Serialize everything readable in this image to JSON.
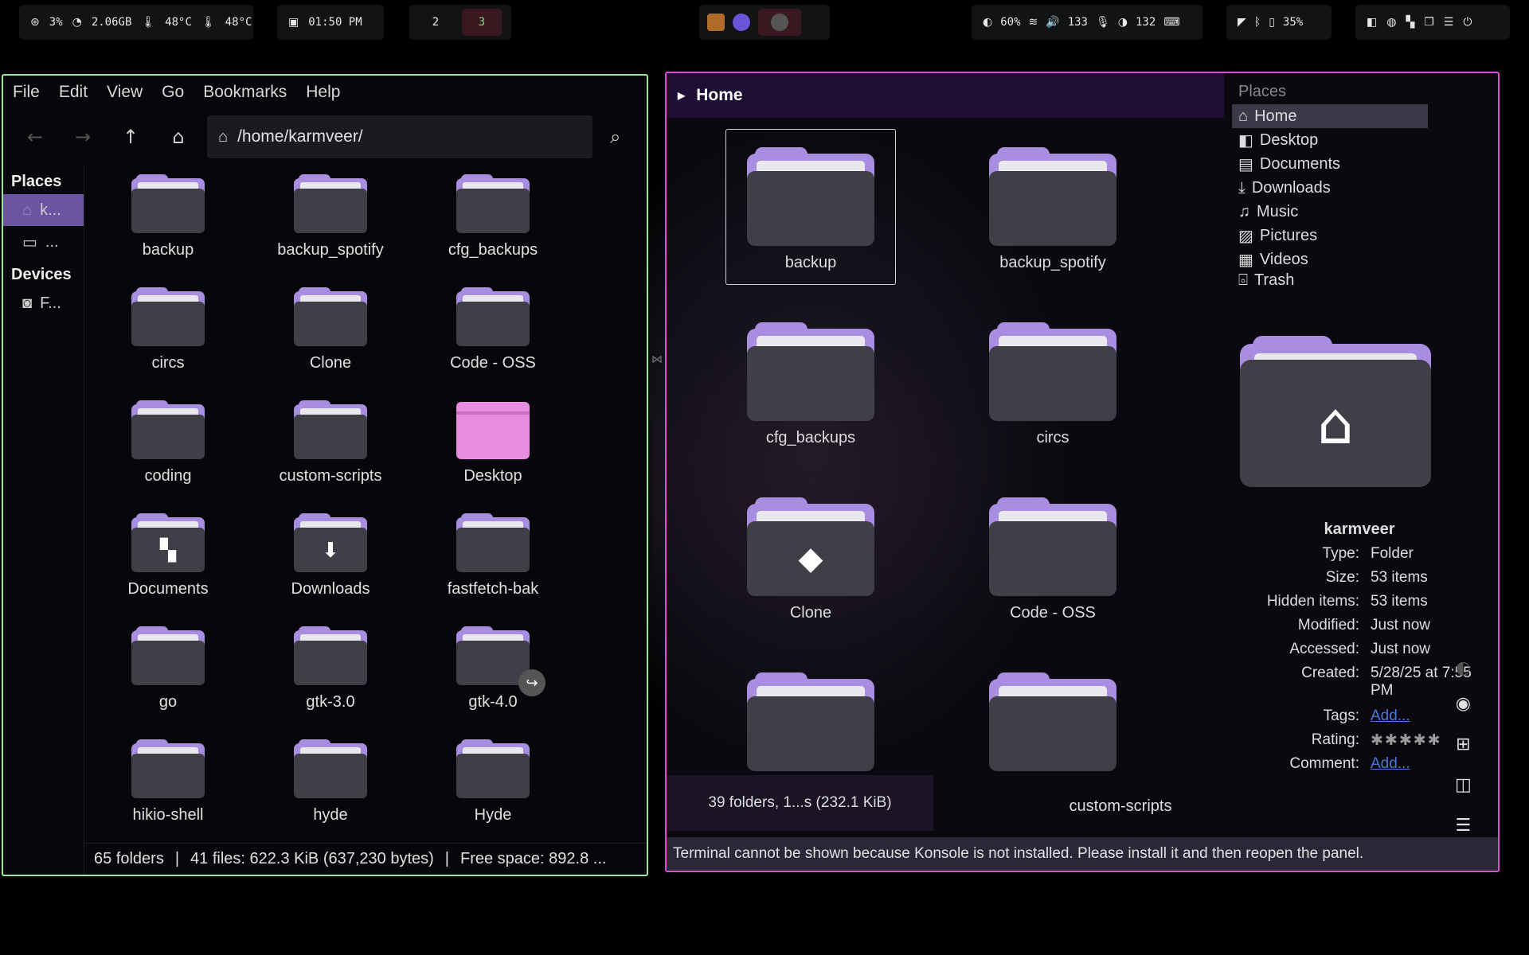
{
  "topbar": {
    "sys": {
      "cpu": "3%",
      "mem": "2.06GB",
      "temp1": "48°C",
      "temp2": "48°C"
    },
    "clock": "01:50 PM",
    "workspaces": [
      "2",
      "3"
    ],
    "controls": {
      "brightness": "60%",
      "volume": "133",
      "mic": "132"
    },
    "battery": "35%"
  },
  "left": {
    "menu": [
      "File",
      "Edit",
      "View",
      "Go",
      "Bookmarks",
      "Help"
    ],
    "path": "/home/karmveer/",
    "sidebar": {
      "places_header": "Places",
      "home_label": "k...",
      "drive_label": "...",
      "devices_header": "Devices",
      "device_label": "F..."
    },
    "items": [
      {
        "name": "backup",
        "type": "folder"
      },
      {
        "name": "backup_spotify",
        "type": "folder"
      },
      {
        "name": "cfg_backups",
        "type": "folder"
      },
      {
        "name": "circs",
        "type": "folder"
      },
      {
        "name": "Clone",
        "type": "folder"
      },
      {
        "name": "Code - OSS",
        "type": "folder"
      },
      {
        "name": "coding",
        "type": "folder"
      },
      {
        "name": "custom-scripts",
        "type": "folder"
      },
      {
        "name": "Desktop",
        "type": "desktop"
      },
      {
        "name": "Documents",
        "type": "documents"
      },
      {
        "name": "Downloads",
        "type": "downloads"
      },
      {
        "name": "fastfetch-bak",
        "type": "folder"
      },
      {
        "name": "go",
        "type": "folder"
      },
      {
        "name": "gtk-3.0",
        "type": "folder"
      },
      {
        "name": "gtk-4.0",
        "type": "link"
      },
      {
        "name": "hikio-shell",
        "type": "folder"
      },
      {
        "name": "hyde",
        "type": "folder"
      },
      {
        "name": "Hyde",
        "type": "folder"
      }
    ],
    "status": {
      "folders": "65 folders",
      "files": "41 files: 622.3 KiB (637,230 bytes)",
      "free": "Free space: 892.8 ..."
    }
  },
  "right": {
    "header": "Home",
    "items": [
      "backup",
      "backup_spotify",
      "cfg_backups",
      "circs",
      "Clone",
      "Code - OSS",
      "",
      ""
    ],
    "last_label": "custom-scripts",
    "status": "39 folders, 1...s (232.1 KiB)",
    "terminal": "Terminal cannot be shown because Konsole is not installed. Please install it and then reopen the panel.",
    "places_header": "Places",
    "places": [
      "Home",
      "Desktop",
      "Documents",
      "Downloads",
      "Music",
      "Pictures",
      "Videos",
      "Trash"
    ],
    "info": {
      "name": "karmveer",
      "type_k": "Type:",
      "type_v": "Folder",
      "size_k": "Size:",
      "size_v": "53 items",
      "hidden_k": "Hidden items:",
      "hidden_v": "53 items",
      "mod_k": "Modified:",
      "mod_v": "Just now",
      "acc_k": "Accessed:",
      "acc_v": "Just now",
      "cre_k": "Created:",
      "cre_v": "5/28/25 at 7:55 PM",
      "tags_k": "Tags:",
      "tags_v": "Add...",
      "rating_k": "Rating:",
      "rating_stars": 5,
      "comment_k": "Comment:",
      "comment_v": "Add..."
    }
  },
  "colors": {
    "left_border": "#9be89b",
    "right_border": "#e04bd3",
    "accent": "#a98de0",
    "selection": "#6d54a3"
  }
}
